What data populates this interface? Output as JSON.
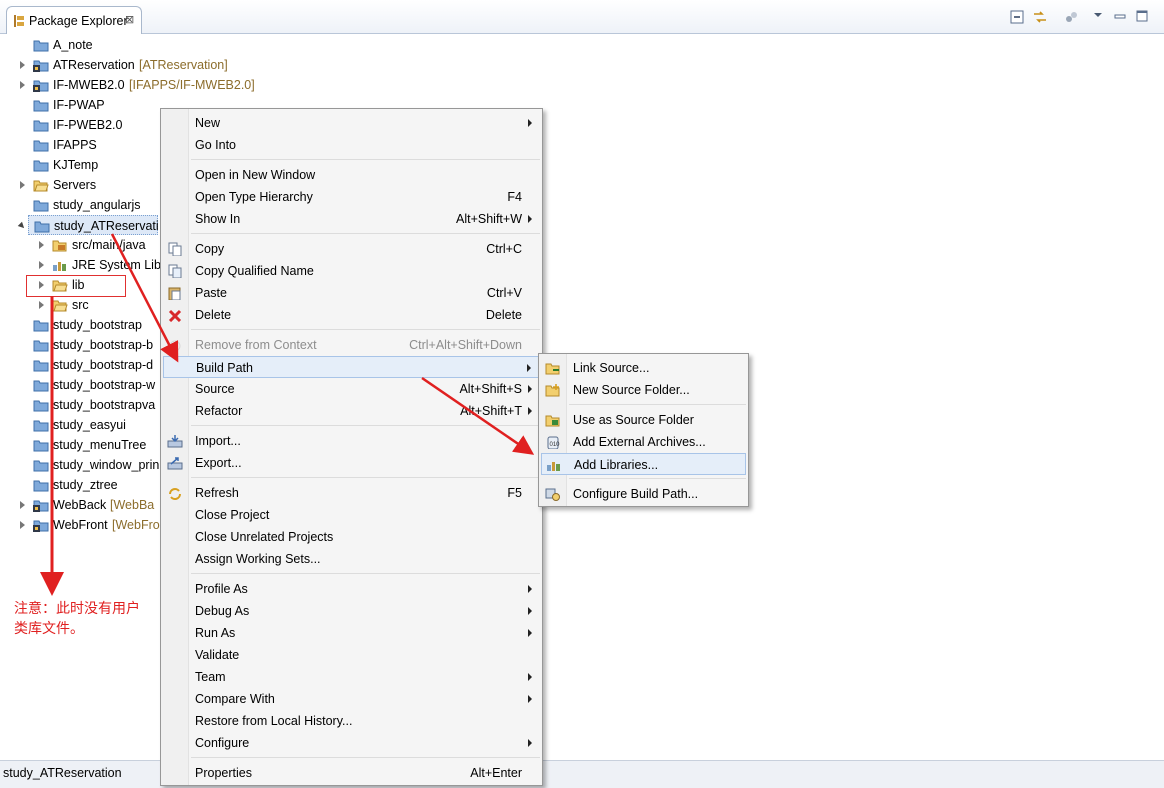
{
  "view": {
    "tab_label": "Package Explorer",
    "tab_close": "⊠",
    "toolbar_icons": [
      "collapse-all-icon",
      "link-with-editor-icon",
      "view-menu-icon",
      "minimize-icon",
      "maximize-icon"
    ]
  },
  "tree": [
    {
      "label": "A_note",
      "deco": "",
      "twisty": "none",
      "icon": "project-folder-icon",
      "level": 0
    },
    {
      "label": "ATReservation",
      "deco": "[ATReservation]",
      "twisty": "closed",
      "icon": "svn-project-icon",
      "level": 0
    },
    {
      "label": "IF-MWEB2.0",
      "deco": "[IFAPPS/IF-MWEB2.0]",
      "twisty": "closed",
      "icon": "svn-project-icon",
      "level": 0
    },
    {
      "label": "IF-PWAP",
      "deco": "",
      "twisty": "none",
      "icon": "project-folder-icon",
      "level": 0
    },
    {
      "label": "IF-PWEB2.0",
      "deco": "",
      "twisty": "none",
      "icon": "project-folder-icon",
      "level": 0
    },
    {
      "label": "IFAPPS",
      "deco": "",
      "twisty": "none",
      "icon": "project-folder-icon",
      "level": 0
    },
    {
      "label": "KJTemp",
      "deco": "",
      "twisty": "none",
      "icon": "project-folder-icon",
      "level": 0
    },
    {
      "label": "Servers",
      "deco": "",
      "twisty": "closed",
      "icon": "open-folder-icon",
      "level": 0
    },
    {
      "label": "study_angularjs",
      "deco": "",
      "twisty": "none",
      "icon": "project-folder-icon",
      "level": 0
    },
    {
      "label": "study_ATReservati",
      "deco": "",
      "twisty": "open",
      "icon": "project-folder-icon",
      "level": 0,
      "selected": true
    },
    {
      "label": "src/main/java",
      "deco": "",
      "twisty": "closed",
      "icon": "source-folder-icon",
      "level": 1
    },
    {
      "label": "JRE System Lib",
      "deco": "",
      "twisty": "closed",
      "icon": "library-icon",
      "level": 1
    },
    {
      "label": "lib",
      "deco": "",
      "twisty": "closed",
      "icon": "open-folder-icon",
      "level": 1
    },
    {
      "label": "src",
      "deco": "",
      "twisty": "closed",
      "icon": "open-folder-icon",
      "level": 1
    },
    {
      "label": "study_bootstrap",
      "deco": "",
      "twisty": "none",
      "icon": "project-folder-icon",
      "level": 0
    },
    {
      "label": "study_bootstrap-b",
      "deco": "",
      "twisty": "none",
      "icon": "project-folder-icon",
      "level": 0
    },
    {
      "label": "study_bootstrap-d",
      "deco": "",
      "twisty": "none",
      "icon": "project-folder-icon",
      "level": 0
    },
    {
      "label": "study_bootstrap-w",
      "deco": "",
      "twisty": "none",
      "icon": "project-folder-icon",
      "level": 0
    },
    {
      "label": "study_bootstrapva",
      "deco": "",
      "twisty": "none",
      "icon": "project-folder-icon",
      "level": 0
    },
    {
      "label": "study_easyui",
      "deco": "",
      "twisty": "none",
      "icon": "project-folder-icon",
      "level": 0
    },
    {
      "label": "study_menuTree",
      "deco": "",
      "twisty": "none",
      "icon": "project-folder-icon",
      "level": 0
    },
    {
      "label": "study_window_prin",
      "deco": "",
      "twisty": "none",
      "icon": "project-folder-icon",
      "level": 0
    },
    {
      "label": "study_ztree",
      "deco": "",
      "twisty": "none",
      "icon": "project-folder-icon",
      "level": 0
    },
    {
      "label": "WebBack",
      "deco": "[WebBa",
      "twisty": "closed",
      "icon": "svn-project-icon",
      "level": 0
    },
    {
      "label": "WebFront",
      "deco": "[WebFro",
      "twisty": "closed",
      "icon": "svn-project-icon",
      "level": 0
    }
  ],
  "context_menu": [
    {
      "type": "item",
      "label": "New",
      "shortcut": "",
      "submenu": true
    },
    {
      "type": "item",
      "label": "Go Into",
      "shortcut": ""
    },
    {
      "type": "sep"
    },
    {
      "type": "item",
      "label": "Open in New Window",
      "shortcut": ""
    },
    {
      "type": "item",
      "label": "Open Type Hierarchy",
      "shortcut": "F4"
    },
    {
      "type": "item",
      "label": "Show In",
      "shortcut": "Alt+Shift+W",
      "submenu": true
    },
    {
      "type": "sep"
    },
    {
      "type": "item",
      "label": "Copy",
      "shortcut": "Ctrl+C",
      "icon": "copy-icon"
    },
    {
      "type": "item",
      "label": "Copy Qualified Name",
      "shortcut": "",
      "icon": "copy-qualified-name-icon"
    },
    {
      "type": "item",
      "label": "Paste",
      "shortcut": "Ctrl+V",
      "icon": "paste-icon"
    },
    {
      "type": "item",
      "label": "Delete",
      "shortcut": "Delete",
      "icon": "delete-icon"
    },
    {
      "type": "sep"
    },
    {
      "type": "item",
      "label": "Remove from Context",
      "shortcut": "Ctrl+Alt+Shift+Down",
      "icon": "remove-context-icon",
      "disabled": true
    },
    {
      "type": "item",
      "label": "Build Path",
      "shortcut": "",
      "submenu": true,
      "highlight": true
    },
    {
      "type": "item",
      "label": "Source",
      "shortcut": "Alt+Shift+S",
      "submenu": true
    },
    {
      "type": "item",
      "label": "Refactor",
      "shortcut": "Alt+Shift+T",
      "submenu": true
    },
    {
      "type": "sep"
    },
    {
      "type": "item",
      "label": "Import...",
      "shortcut": "",
      "icon": "import-icon"
    },
    {
      "type": "item",
      "label": "Export...",
      "shortcut": "",
      "icon": "export-icon"
    },
    {
      "type": "sep"
    },
    {
      "type": "item",
      "label": "Refresh",
      "shortcut": "F5",
      "icon": "refresh-icon"
    },
    {
      "type": "item",
      "label": "Close Project",
      "shortcut": ""
    },
    {
      "type": "item",
      "label": "Close Unrelated Projects",
      "shortcut": ""
    },
    {
      "type": "item",
      "label": "Assign Working Sets...",
      "shortcut": ""
    },
    {
      "type": "sep"
    },
    {
      "type": "item",
      "label": "Profile As",
      "shortcut": "",
      "submenu": true
    },
    {
      "type": "item",
      "label": "Debug As",
      "shortcut": "",
      "submenu": true
    },
    {
      "type": "item",
      "label": "Run As",
      "shortcut": "",
      "submenu": true
    },
    {
      "type": "item",
      "label": "Validate",
      "shortcut": ""
    },
    {
      "type": "item",
      "label": "Team",
      "shortcut": "",
      "submenu": true
    },
    {
      "type": "item",
      "label": "Compare With",
      "shortcut": "",
      "submenu": true
    },
    {
      "type": "item",
      "label": "Restore from Local History...",
      "shortcut": ""
    },
    {
      "type": "item",
      "label": "Configure",
      "shortcut": "",
      "submenu": true
    },
    {
      "type": "sep"
    },
    {
      "type": "item",
      "label": "Properties",
      "shortcut": "Alt+Enter"
    }
  ],
  "build_path_submenu": [
    {
      "type": "item",
      "label": "Link Source...",
      "icon": "link-source-icon"
    },
    {
      "type": "item",
      "label": "New Source Folder...",
      "icon": "new-source-folder-icon"
    },
    {
      "type": "sep"
    },
    {
      "type": "item",
      "label": "Use as Source Folder",
      "icon": "use-as-source-icon"
    },
    {
      "type": "item",
      "label": "Add External Archives...",
      "icon": "jar-icon"
    },
    {
      "type": "item",
      "label": "Add Libraries...",
      "icon": "library-icon",
      "highlight": true
    },
    {
      "type": "sep"
    },
    {
      "type": "item",
      "label": "Configure Build Path...",
      "icon": "configure-build-path-icon"
    }
  ],
  "annotation": {
    "note": "注意：此时没有用户类库文件。",
    "color": "#e02020"
  },
  "status_bar": {
    "text": "study_ATReservation"
  }
}
